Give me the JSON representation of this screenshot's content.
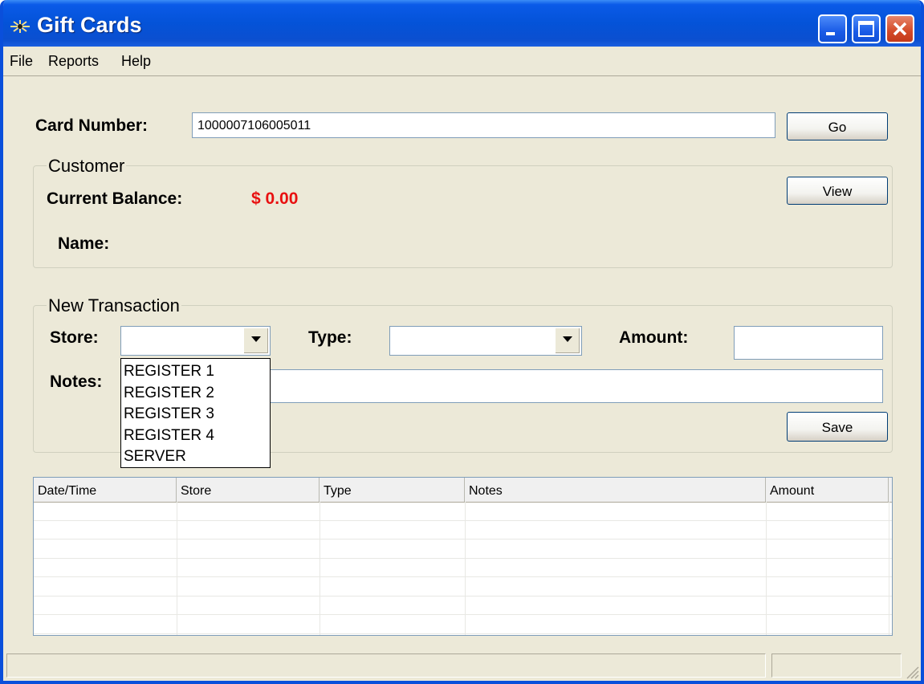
{
  "window": {
    "title": "Gift Cards"
  },
  "menu": [
    "File",
    "Reports",
    "Help"
  ],
  "card": {
    "label": "Card Number:",
    "value": "1000007106005011",
    "go_label": "Go"
  },
  "customer": {
    "legend": "Customer",
    "balance_label": "Current Balance:",
    "balance_value": "$ 0.00",
    "name_label": "Name:",
    "view_label": "View"
  },
  "transaction": {
    "legend": "New Transaction",
    "store_label": "Store:",
    "store_value": "",
    "type_label": "Type:",
    "type_value": "",
    "amount_label": "Amount:",
    "amount_value": "",
    "notes_label": "Notes:",
    "notes_value": "",
    "save_label": "Save",
    "store_options": [
      "REGISTER 1",
      "REGISTER 2",
      "REGISTER 3",
      "REGISTER 4",
      "SERVER"
    ]
  },
  "history": {
    "columns": [
      "Date/Time",
      "Store",
      "Type",
      "Notes",
      "Amount"
    ],
    "rows": []
  },
  "colors": {
    "balance": "#E81010",
    "title_bar": "#0453D8"
  }
}
